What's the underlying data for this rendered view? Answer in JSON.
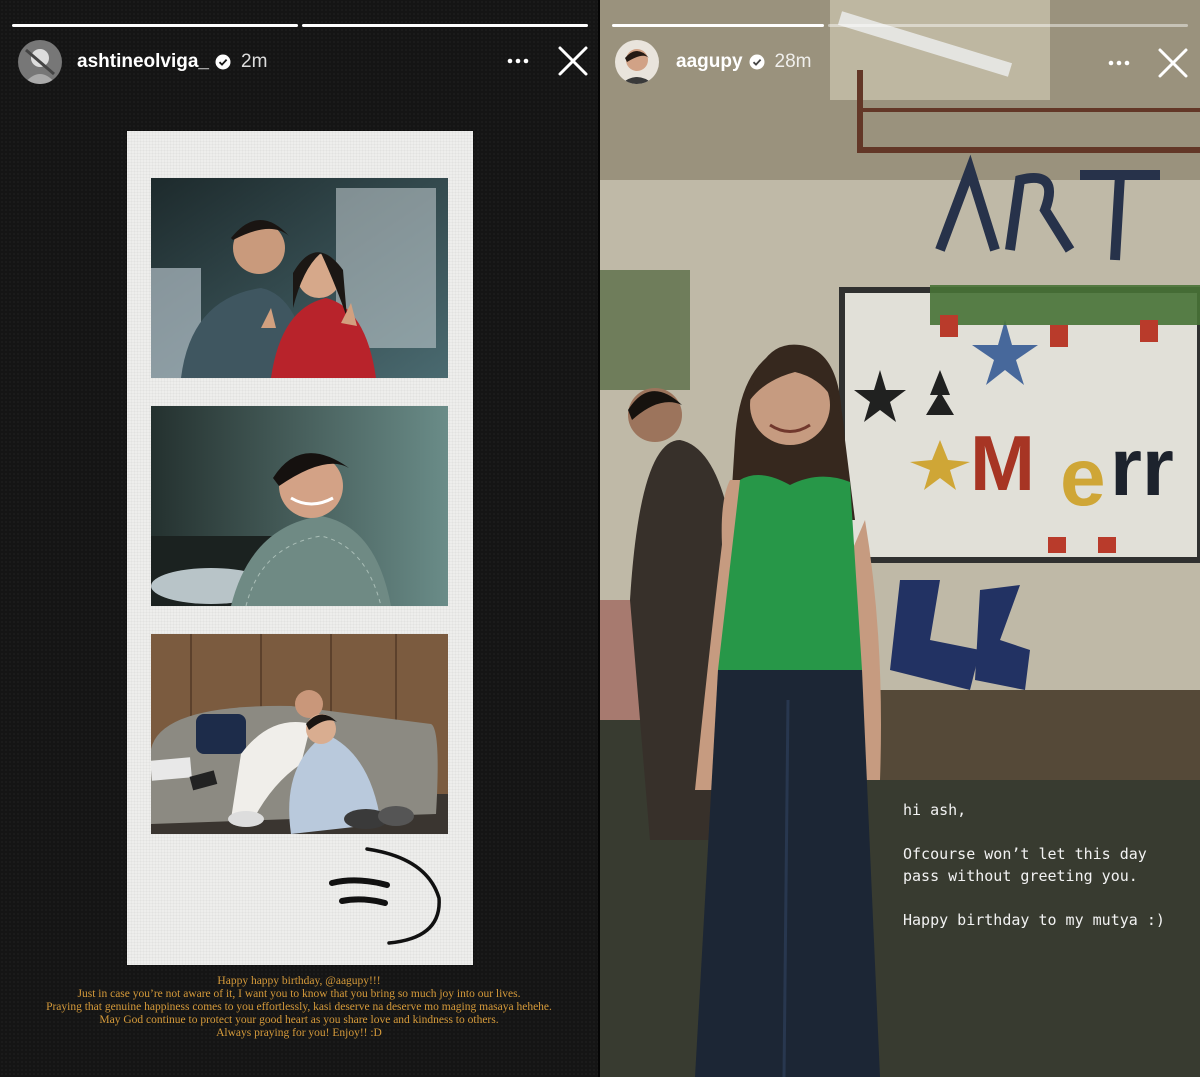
{
  "left_story": {
    "progress": [
      1.0,
      1.0
    ],
    "username": "ashtineolviga_",
    "verified": true,
    "timestamp": "2m",
    "photos": [
      {
        "scene": "couple-smiling-hand-signs"
      },
      {
        "scene": "young-man-smiling-checked-shirt"
      },
      {
        "scene": "couple-on-couch"
      }
    ],
    "drawing": "smiley-face-doodle",
    "caption_lines": [
      "Happy happy birthday, @aagupy!!!",
      "Just in case you’re not aware of it, I want you to know that you bring so much joy into our lives.",
      "Praying that genuine happiness comes to you effortlessly, kasi deserve na deserve mo maging masaya hehehe.",
      "",
      "May God continue to protect your good heart as you share love and kindness to others.",
      "Always praying for you! Enjoy!! :D"
    ],
    "caption_color": "#d59a3a"
  },
  "right_story": {
    "progress": [
      1.0,
      0.0
    ],
    "username": "aagupy",
    "verified": true,
    "timestamp": "28m",
    "photo": {
      "scene": "woman-green-top-christmas-board"
    },
    "note_lines": [
      "hi ash,",
      "",
      "Ofcourse won’t let this day",
      "pass without greeting you.",
      "",
      "Happy birthday to my mutya :)"
    ]
  },
  "icons": {
    "more": "more-horizontal-icon",
    "close": "close-icon",
    "verified": "verified-badge-icon"
  }
}
